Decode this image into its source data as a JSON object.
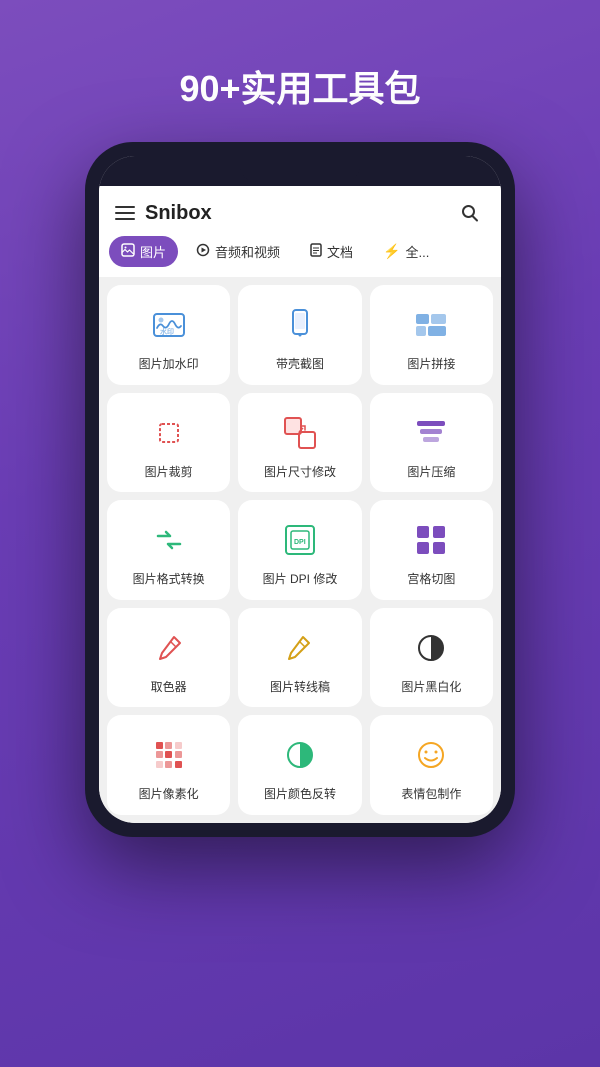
{
  "headline": "90+实用工具包",
  "app": {
    "title": "Snibox"
  },
  "tabs": [
    {
      "label": "图片",
      "active": true,
      "icon": "🖼"
    },
    {
      "label": "音频和视频",
      "active": false,
      "icon": "▶"
    },
    {
      "label": "文档",
      "active": false,
      "icon": "📄"
    },
    {
      "label": "全...",
      "active": false,
      "icon": "⚡"
    }
  ],
  "tools": [
    {
      "label": "图片加水印",
      "icon": "watermark",
      "color": "#4a90d9"
    },
    {
      "label": "带壳截图",
      "icon": "screenshot",
      "color": "#4a90d9"
    },
    {
      "label": "图片拼接",
      "icon": "collage",
      "color": "#4a90d9"
    },
    {
      "label": "图片裁剪",
      "icon": "crop",
      "color": "#e05252"
    },
    {
      "label": "图片尺寸修改",
      "icon": "resize",
      "color": "#e05252"
    },
    {
      "label": "图片压缩",
      "icon": "compress",
      "color": "#7c4dbd"
    },
    {
      "label": "图片格式转换",
      "icon": "convert",
      "color": "#2db87a"
    },
    {
      "label": "图片 DPI 修改",
      "icon": "dpi",
      "color": "#2db87a"
    },
    {
      "label": "宫格切图",
      "icon": "grid",
      "color": "#7c4dbd"
    },
    {
      "label": "取色器",
      "icon": "picker",
      "color": "#e05252"
    },
    {
      "label": "图片转线稿",
      "icon": "sketch",
      "color": "#d4a017"
    },
    {
      "label": "图片黑白化",
      "icon": "bw",
      "color": "#333"
    },
    {
      "label": "图片像素化",
      "icon": "pixel",
      "color": "#e05252"
    },
    {
      "label": "图片颜色反转",
      "icon": "invert",
      "color": "#2db87a"
    },
    {
      "label": "表情包制作",
      "icon": "emoji",
      "color": "#f5a623"
    }
  ]
}
